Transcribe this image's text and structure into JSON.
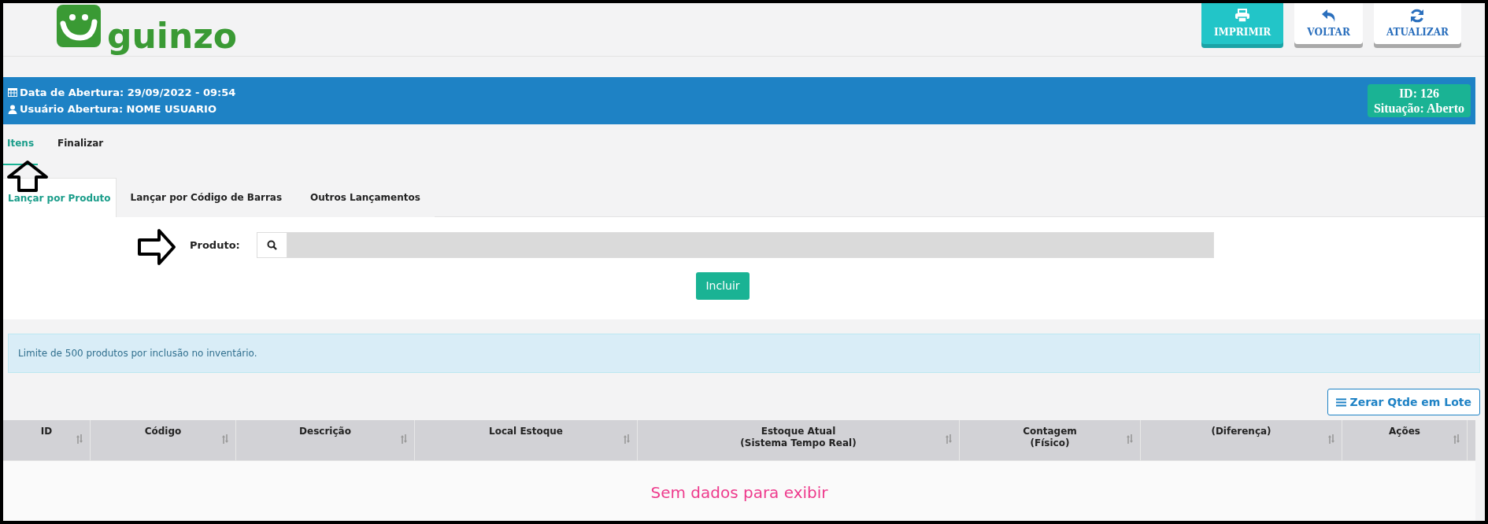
{
  "logo": {
    "text": "guinzo"
  },
  "toolbar": [
    {
      "label": "IMPRIMIR",
      "kind": "primary"
    },
    {
      "label": "VOLTAR",
      "kind": "default"
    },
    {
      "label": "ATUALIZAR",
      "kind": "default"
    }
  ],
  "header": {
    "opened": "Data de Abertura: 29/09/2022 - 09:54",
    "user": "Usuário Abertura: NOME USUARIO",
    "badge_id": "ID: 126",
    "badge_status": "Situação: Aberto"
  },
  "tabs": [
    {
      "label": "Itens",
      "selected": true
    },
    {
      "label": "Finalizar",
      "selected": false
    }
  ],
  "subtabs": [
    {
      "label": "Lançar por Produto",
      "selected": true
    },
    {
      "label": "Lançar por Código de Barras",
      "selected": false
    },
    {
      "label": "Outros Lançamentos",
      "selected": false
    }
  ],
  "product": {
    "label": "Produto:",
    "button": "Incluir"
  },
  "alert": "Limite de 500 produtos por inclusão no inventário.",
  "batch_button": "Zerar Qtde em Lote",
  "table": {
    "columns": [
      "ID",
      "Código",
      "Descrição",
      "Local Estoque",
      "Estoque Atual\n(Sistema Tempo Real)",
      "Contagem\n(Físico)",
      "(Diferença)",
      "Ações"
    ],
    "empty": "Sem dados para exibir"
  }
}
